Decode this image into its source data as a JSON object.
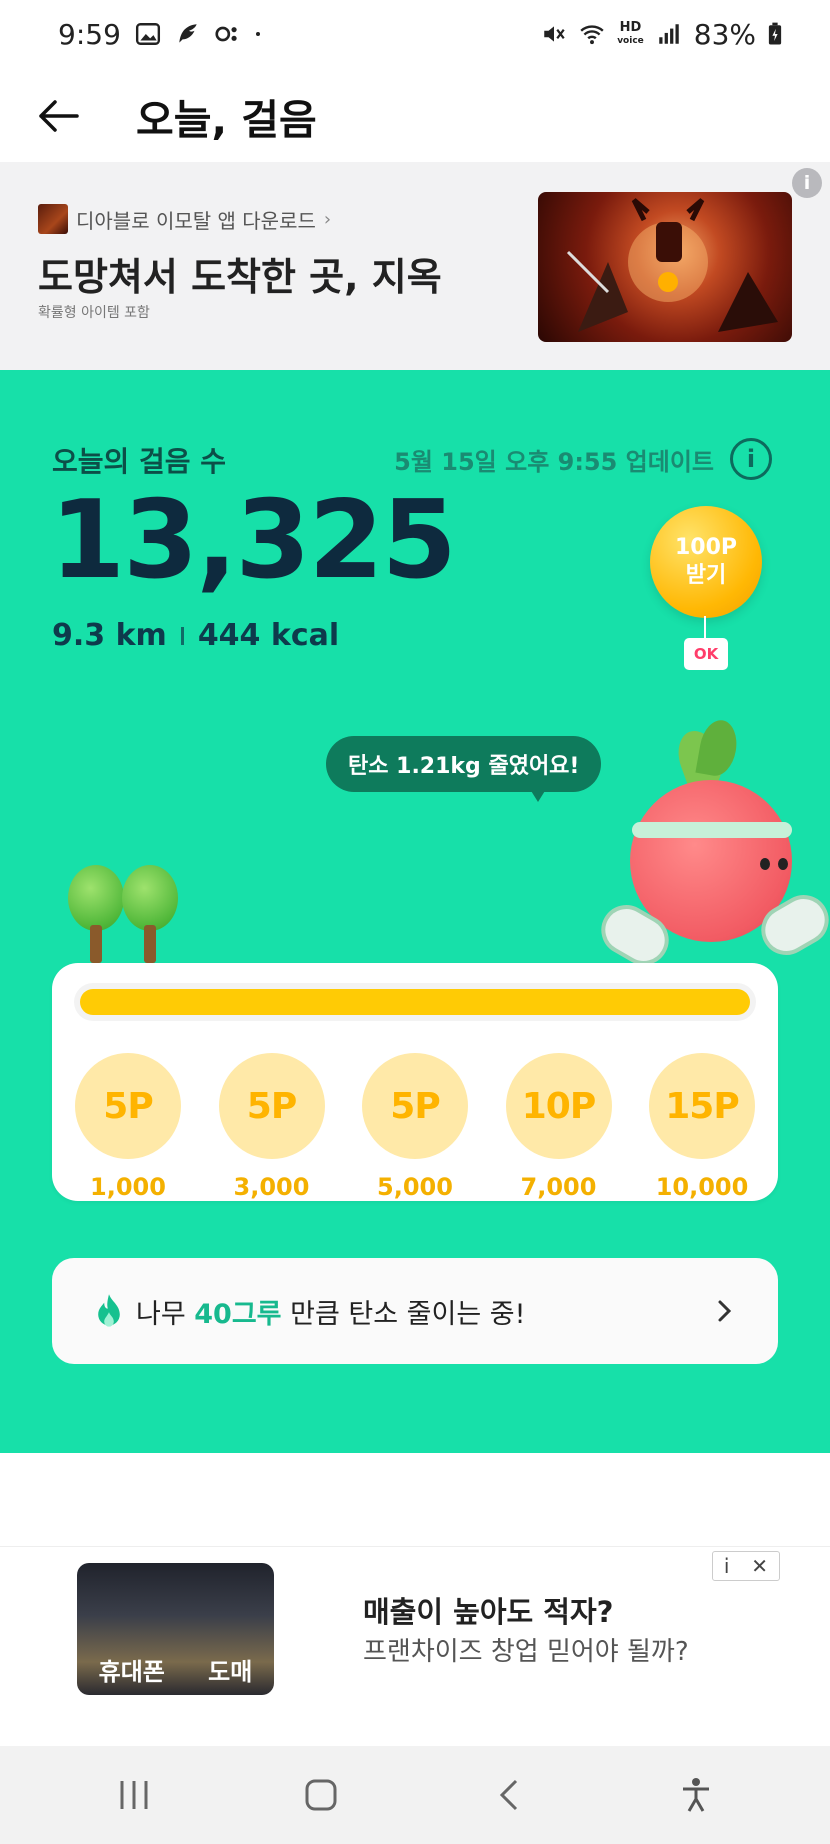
{
  "status_bar": {
    "time": "9:59",
    "battery": "83%",
    "hd_label": "HD",
    "voice_label": "voice"
  },
  "header": {
    "title": "오늘, 걸음"
  },
  "top_ad": {
    "source": "디아블로 이모탈 앱 다운로드",
    "headline": "도망쳐서 도착한 곳, 지옥",
    "note": "확률형 아이템 포함",
    "info": "i"
  },
  "steps": {
    "label": "오늘의 걸음 수",
    "updated": "5월 15일 오후 9:55 업데이트",
    "count": "13,325",
    "distance": "9.3 km",
    "calories": "444 kcal",
    "progress": 1.0
  },
  "reward": {
    "line1": "100P",
    "line2": "받기",
    "badge": "OK"
  },
  "bubble": {
    "text": "탄소 1.21kg 줄였어요!"
  },
  "milestones": [
    {
      "points": "5P",
      "steps": "1,000"
    },
    {
      "points": "5P",
      "steps": "3,000"
    },
    {
      "points": "5P",
      "steps": "5,000"
    },
    {
      "points": "10P",
      "steps": "7,000"
    },
    {
      "points": "15P",
      "steps": "10,000"
    }
  ],
  "carbon": {
    "prefix": "나무 ",
    "highlight": "40그루",
    "suffix": " 만큼 탄소 줄이는 중!"
  },
  "bottom_ad": {
    "title": "매출이 높아도 적자?",
    "subtitle": "프랜차이즈 창업 믿어야 될까?",
    "sign_left": "휴대폰",
    "sign_right": "도매",
    "info": "i",
    "close": "✕"
  },
  "colors": {
    "green": "#17e0a9",
    "yellow": "#ffcb05",
    "coin": "#ffe9a8"
  }
}
